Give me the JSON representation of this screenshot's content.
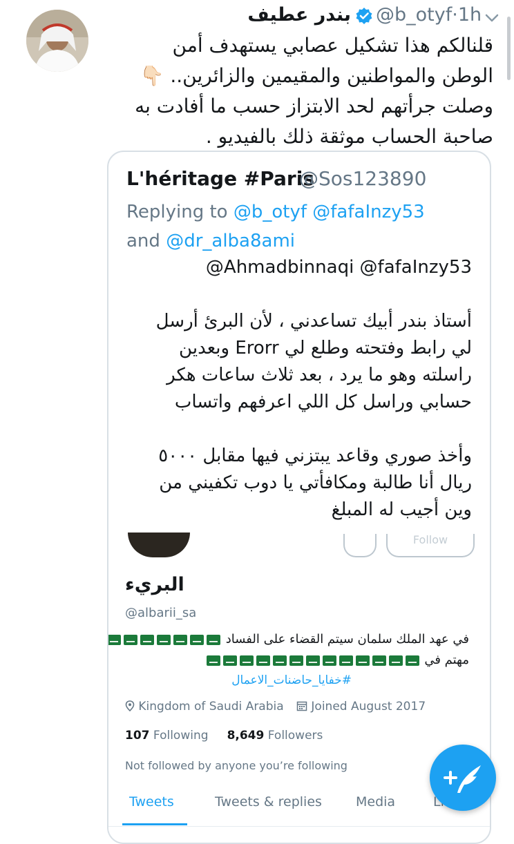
{
  "tweet": {
    "author_name": "بندر عطيف",
    "author_handle": "@b_otyf",
    "separator": "·",
    "time": "1h",
    "text": "قلنالكم هذا تشكيل عصابي يستهدف أمن\nالوطن والمواطنين والمقيمين والزائرين.. 👇🏻\nوصلت جرأتهم لحد الابتزاز حسب ما أفادت به\nصاحبة الحساب موثقة ذلك بالفيديو ."
  },
  "quoted": {
    "name": "L'héritage #Paris",
    "handle": "@Sos123890",
    "replying_prefix": "Replying to",
    "reply_to_1": "@b_otyf",
    "reply_to_2": "@fafaInzy53",
    "reply_and": "and",
    "reply_to_3": "@dr_alba8ami",
    "mentions": "@Ahmadbinnaqi @fafaInzy53",
    "body": "أستاذ بندر أبيك تساعدني ، لأن البرئ أرسل\nلي رابط وفتحته وطلع لي Erorr وبعدين\nراسلته وهو ما يرد ، بعد ثلاث ساعات هكر\nحسابي وراسل كل اللي اعرفهم واتساب\n\nوأخذ صوري وقاعد يبتزني فيها مقابل ٥٠٠٠\nريال أنا طالبة ومكافأتي يا دوب تكفيني من\nوين أجيب له المبلغ"
  },
  "profile": {
    "follow_button": "Follow",
    "name": "البريء",
    "handle": "@albarii_sa",
    "bio_line1": "في عهد الملك سلمان سيتم القضاء على الفساد",
    "bio_line2": "مهتم في",
    "hashtag": "#خفايا_حاضنات_الاعمال",
    "location": "Kingdom of Saudi Arabia",
    "joined": "Joined August 2017",
    "following_count": "107",
    "following_label": "Following",
    "followers_count": "8,649",
    "followers_label": "Followers",
    "not_followed": "Not followed by anyone you’re following",
    "tabs": [
      "Tweets",
      "Tweets & replies",
      "Media",
      "Li"
    ]
  },
  "colors": {
    "accent": "#1da1f2",
    "secondary_text": "#657786",
    "primary_text": "#14171a",
    "border": "#d8dfe5",
    "flag_green": "#1b7a3a"
  },
  "icons": {
    "chevron": "chevron-down-icon",
    "verified": "verified-badge-icon",
    "compose": "compose-tweet-icon",
    "location": "location-pin-icon",
    "calendar": "calendar-icon",
    "flag": "saudi-flag-emoji"
  }
}
